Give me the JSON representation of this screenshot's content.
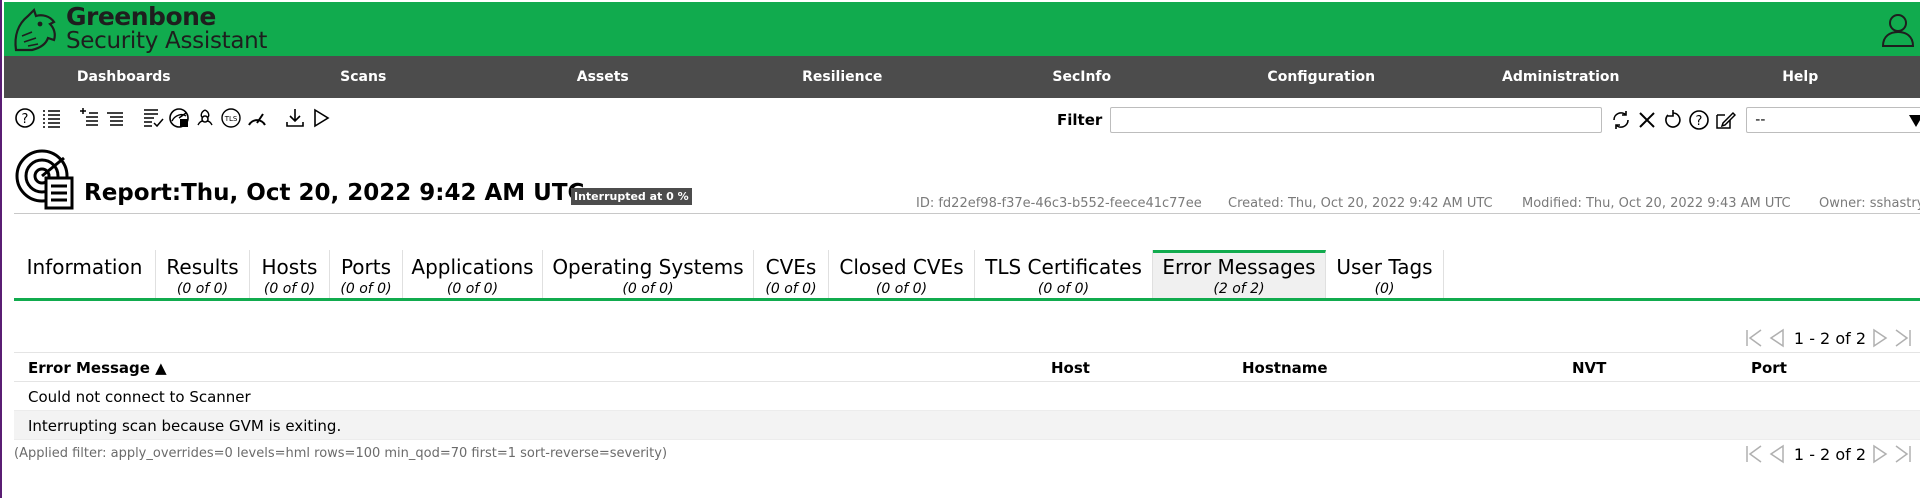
{
  "app": {
    "brand_line1": "Greenbone",
    "brand_line2": "Security Assistant",
    "colors": {
      "header_green": "#11ab4e",
      "nav_gray": "#4c4c4c"
    }
  },
  "nav": {
    "items": [
      "Dashboards",
      "Scans",
      "Assets",
      "Resilience",
      "SecInfo",
      "Configuration",
      "Administration",
      "Help"
    ]
  },
  "toolbar": {
    "icons": [
      "help-icon",
      "list-icon",
      "add-to-list-icon",
      "list-details-icon",
      "report-list-icon",
      "results-icon",
      "vulnerability-icon",
      "tls-certificate-icon",
      "performance-icon",
      "download-icon",
      "start-icon"
    ]
  },
  "filter": {
    "label": "Filter",
    "value": "",
    "select_value": "--"
  },
  "report": {
    "title": "Report:Thu, Oct 20, 2022 9:42 AM UTC",
    "status": "Interrupted at 0 %",
    "id": "ID: fd22ef98-f37e-46c3-b552-feece41c77ee",
    "created": "Created: Thu, Oct 20, 2022 9:42 AM UTC",
    "modified": "Modified: Thu, Oct 20, 2022 9:43 AM UTC",
    "owner": "Owner: sshastry"
  },
  "tabs": [
    {
      "label": "Information",
      "count": ""
    },
    {
      "label": "Results",
      "count": "(0 of 0)"
    },
    {
      "label": "Hosts",
      "count": "(0 of 0)"
    },
    {
      "label": "Ports",
      "count": "(0 of 0)"
    },
    {
      "label": "Applications",
      "count": "(0 of 0)"
    },
    {
      "label": "Operating Systems",
      "count": "(0 of 0)"
    },
    {
      "label": "CVEs",
      "count": "(0 of 0)"
    },
    {
      "label": "Closed CVEs",
      "count": "(0 of 0)"
    },
    {
      "label": "TLS Certificates",
      "count": "(0 of 0)"
    },
    {
      "label": "Error Messages",
      "count": "(2 of 2)"
    },
    {
      "label": "User Tags",
      "count": "(0)"
    }
  ],
  "pager": {
    "text": "1 - 2 of 2"
  },
  "table": {
    "headers": {
      "error_message": "Error Message ▲",
      "host": "Host",
      "hostname": "Hostname",
      "nvt": "NVT",
      "port": "Port"
    },
    "rows": [
      {
        "error_message": "Could not connect to Scanner"
      },
      {
        "error_message": "Interrupting scan because GVM is exiting."
      }
    ]
  },
  "applied_filter": "(Applied filter: apply_overrides=0 levels=hml rows=100 min_qod=70 first=1 sort-reverse=severity)"
}
